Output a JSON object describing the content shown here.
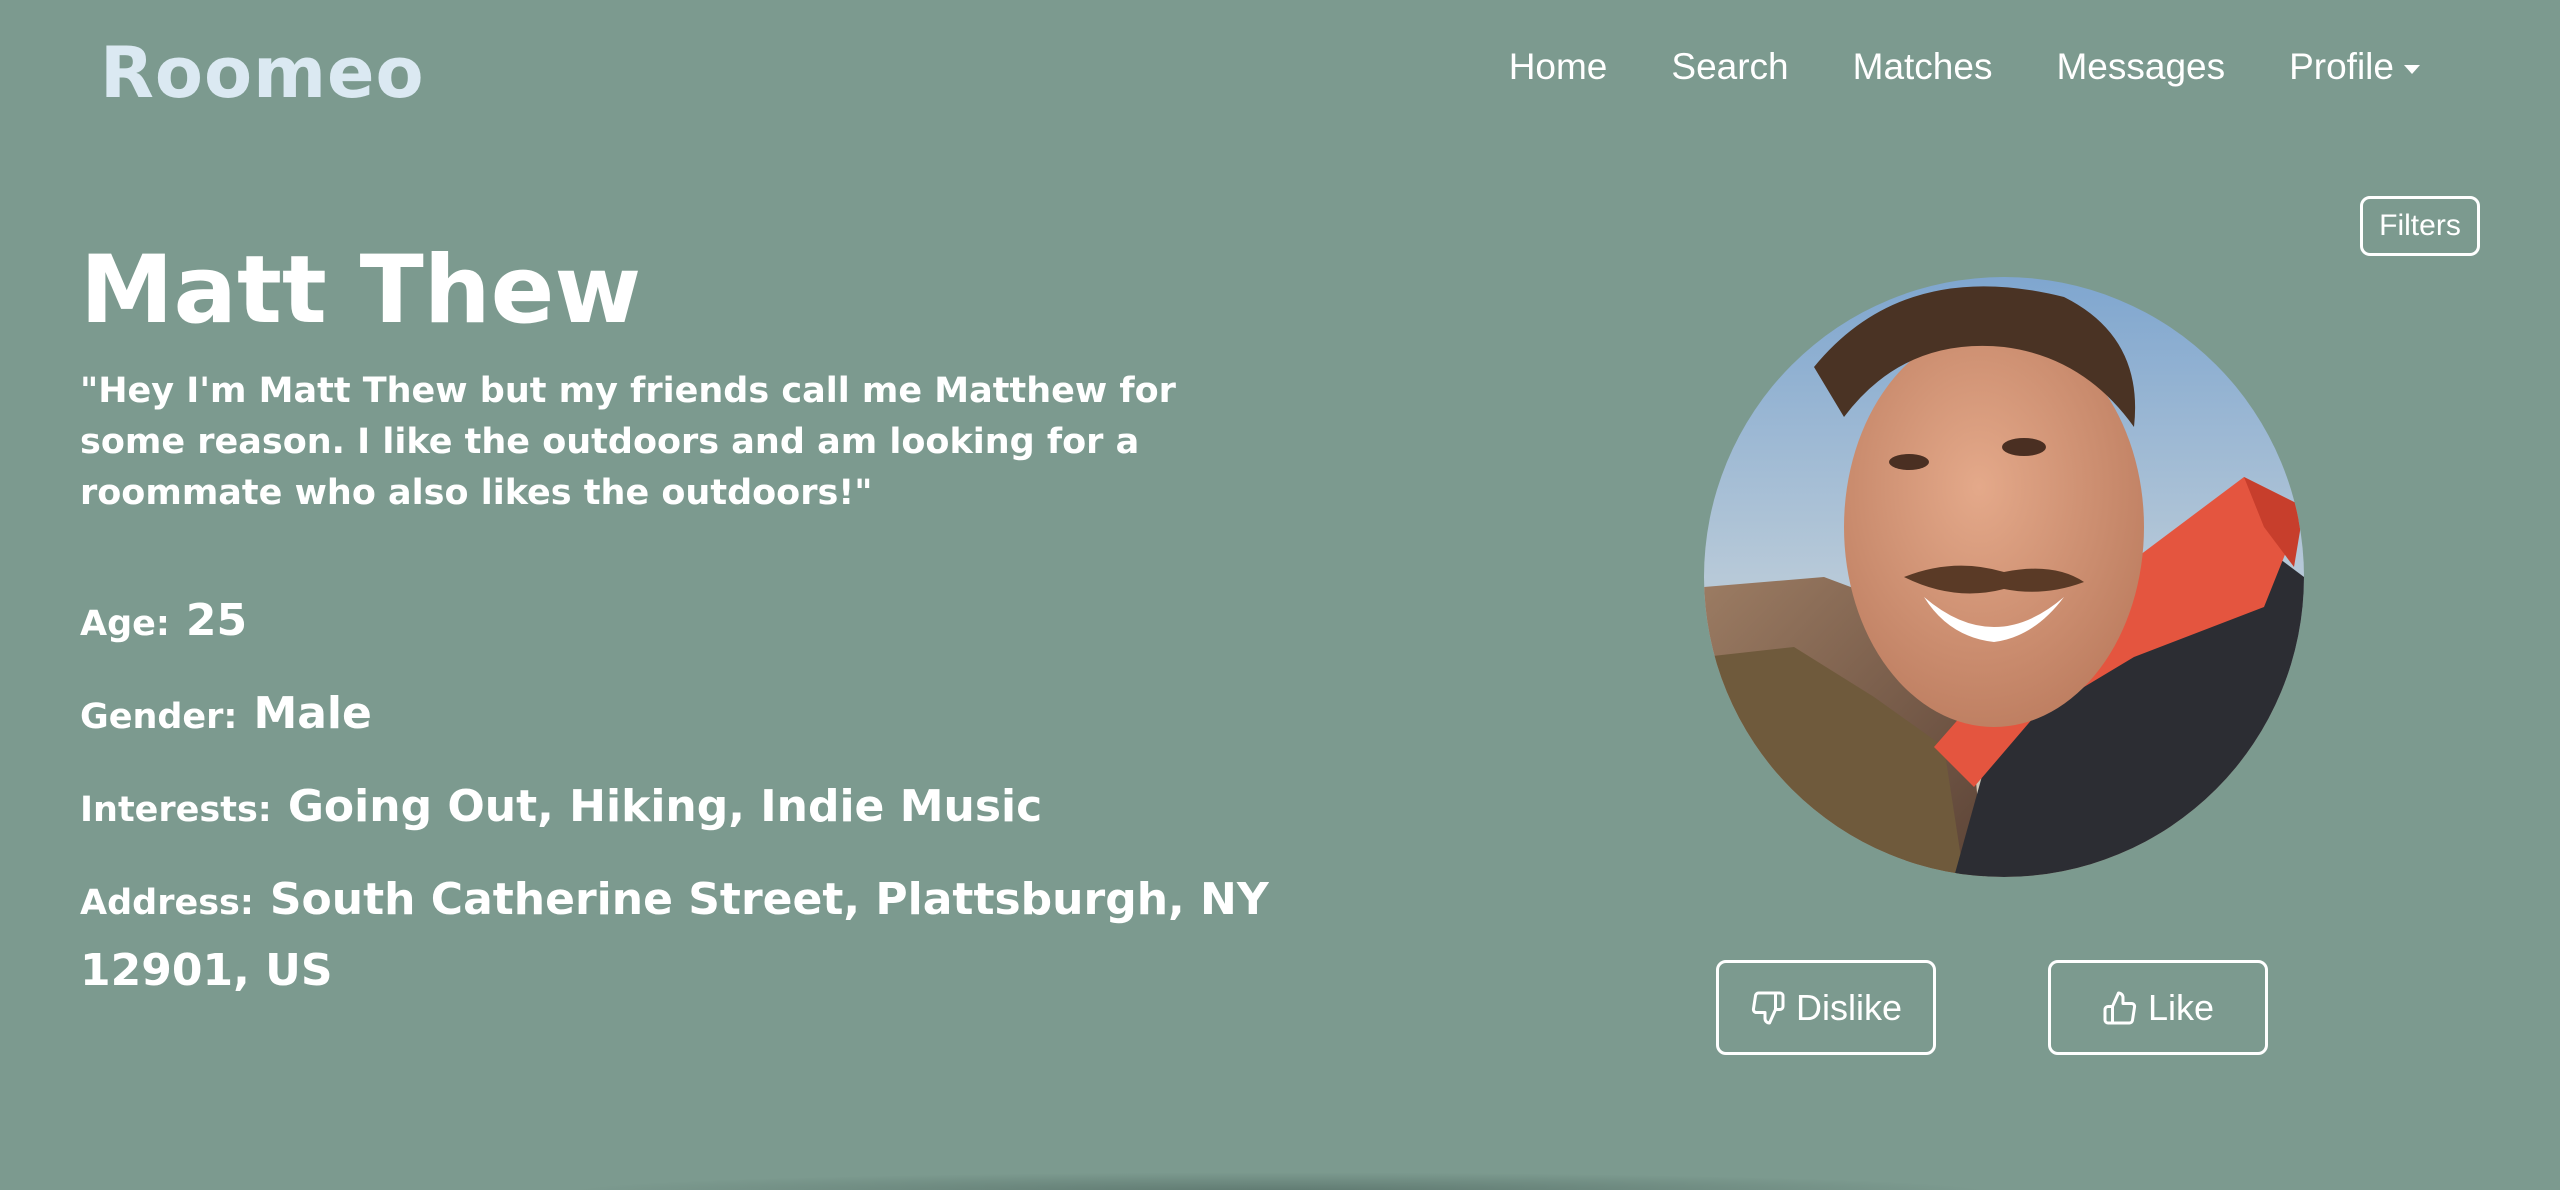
{
  "brand": {
    "logo_text": "Roomeo"
  },
  "nav": {
    "home": "Home",
    "search": "Search",
    "matches": "Matches",
    "messages": "Messages",
    "profile": "Profile"
  },
  "filters_label": "Filters",
  "profile": {
    "name": "Matt Thew",
    "bio": "\"Hey I'm Matt Thew but my friends call me Matthew for some reason. I like the outdoors and am looking for a roommate who also likes the outdoors!\"",
    "age_label": "Age:",
    "age": "25",
    "gender_label": "Gender:",
    "gender": "Male",
    "interests_label": "Interests:",
    "interests": "Going Out, Hiking, Indie Music",
    "address_label": "Address:",
    "address": "South Catherine Street, Plattsburgh, NY 12901, US"
  },
  "actions": {
    "dislike": "Dislike",
    "like": "Like"
  },
  "icons": {
    "dislike": "thumbs-down-icon",
    "like": "thumbs-up-icon",
    "profile_menu": "caret-down-icon"
  },
  "colors": {
    "background": "#7c9a8f",
    "logo": "#dbe9f2",
    "text": "#ffffff"
  }
}
